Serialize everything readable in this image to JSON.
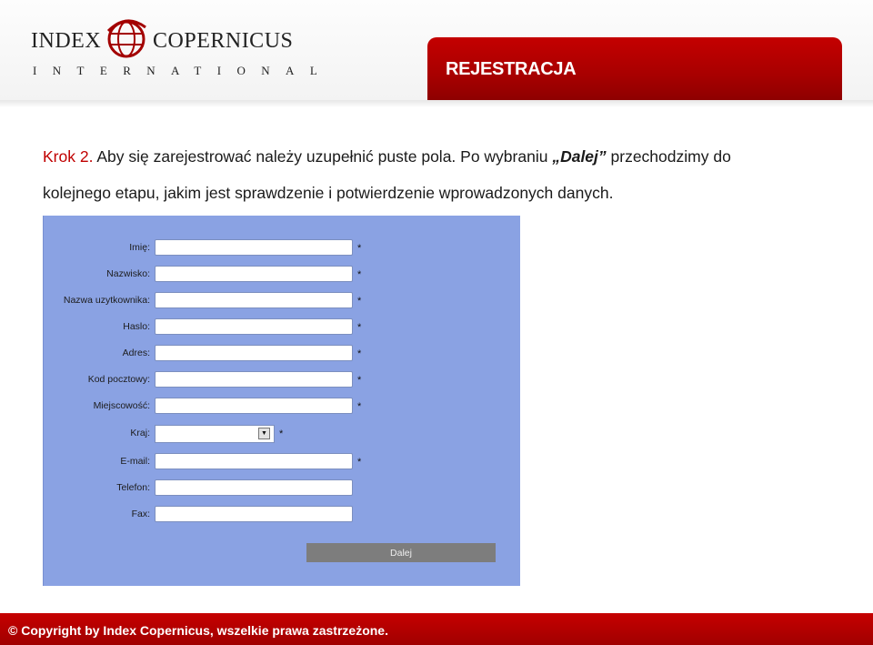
{
  "header": {
    "logo_left": "INDEX",
    "logo_right": "COPERNICUS",
    "logo_sub": "INTERNATIONAL",
    "tab_title": "REJESTRACJA"
  },
  "instructions": {
    "krok": "Krok 2.",
    "line1_text": " Aby się zarejestrować należy uzupełnić puste pola. Po wybraniu ",
    "dalej": "„Dalej”",
    "line1_end": " przechodzimy do",
    "line2": "kolejnego etapu, jakim jest sprawdzenie i potwierdzenie wprowadzonych danych."
  },
  "form": {
    "required_mark": "*",
    "fields": {
      "imie": "Imię:",
      "nazwisko": "Nazwisko:",
      "nazwa_uzytkownika": "Nazwa uzytkownika:",
      "haslo": "Haslo:",
      "adres": "Adres:",
      "kod_pocztowy": "Kod pocztowy:",
      "miejscowosc": "Miejscowość:",
      "kraj": "Kraj:",
      "email": "E-mail:",
      "telefon": "Telefon:",
      "fax": "Fax:"
    },
    "submit_label": "Dalej"
  },
  "footer": {
    "copyright": "© Copyright by Index Copernicus, wszelkie prawa zastrzeżone."
  },
  "colors": {
    "brand_red": "#b00000",
    "form_bg": "#8aa2e3",
    "button_gray": "#7d7d7d"
  }
}
